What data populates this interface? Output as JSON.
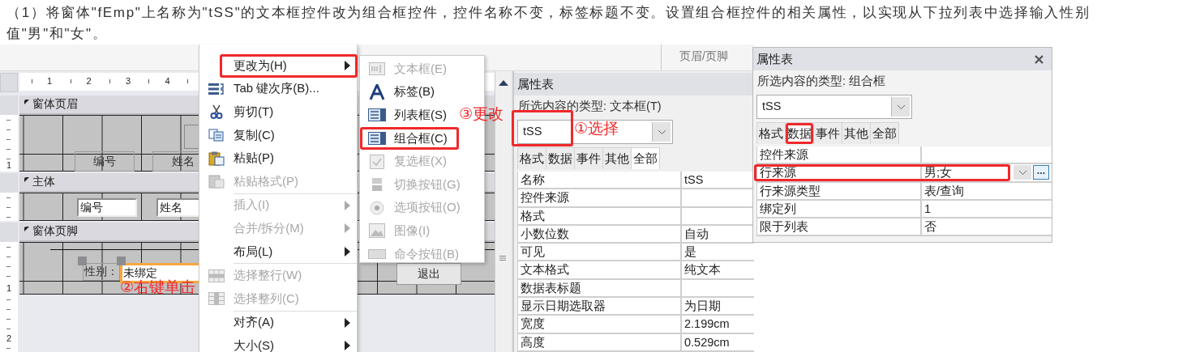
{
  "instruction": "（1）将窗体\"fEmp\"上名称为\"tSS\"的文本框控件改为组合框控件，控件名称不变，标签标题不变。设置组合框控件的相关属性，以实现从下拉列表中选择输入性别值\"男\"和\"女\"。",
  "ribbon": {
    "group_label": "页眉/页脚"
  },
  "designer": {
    "ruler_marks": [
      "1",
      "2",
      "3",
      "4"
    ],
    "sections": [
      {
        "title": "窗体页眉",
        "ruler_numbers": [
          "1"
        ],
        "controls": [
          {
            "kind": "label",
            "text": "编号",
            "selected": false
          },
          {
            "kind": "label",
            "text": "姓名",
            "selected": false
          },
          {
            "kind": "box",
            "selected": false
          }
        ]
      },
      {
        "title": "主体",
        "controls": [
          {
            "kind": "textbox",
            "text": "编号",
            "selected": false
          },
          {
            "kind": "textbox",
            "text": "姓名",
            "selected": false
          }
        ]
      },
      {
        "title": "窗体页脚",
        "ruler_numbers": [
          "1"
        ],
        "controls": [
          {
            "kind": "label",
            "text": "性别：",
            "selected": false
          },
          {
            "kind": "textbox",
            "text": "未绑定",
            "selected": true
          },
          {
            "kind": "button",
            "text": "退出",
            "selected": false
          }
        ]
      }
    ],
    "below_ruler_numbers": [
      "2"
    ]
  },
  "context_menu": {
    "items": [
      {
        "label": "更改为(H)",
        "disabled": false,
        "submenu": true
      },
      {
        "label": "Tab 键次序(B)...",
        "disabled": false,
        "submenu": false
      },
      {
        "label": "剪切(T)",
        "disabled": false,
        "submenu": false
      },
      {
        "label": "复制(C)",
        "disabled": false,
        "submenu": false
      },
      {
        "label": "粘贴(P)",
        "disabled": false,
        "submenu": false
      },
      {
        "label": "粘贴格式(P)",
        "disabled": true,
        "submenu": false
      },
      {
        "label": "插入(I)",
        "disabled": true,
        "submenu": true
      },
      {
        "label": "合并/拆分(M)",
        "disabled": true,
        "submenu": true
      },
      {
        "label": "布局(L)",
        "disabled": false,
        "submenu": true
      },
      {
        "label": "选择整行(W)",
        "disabled": true,
        "submenu": false
      },
      {
        "label": "选择整列(C)",
        "disabled": true,
        "submenu": false
      },
      {
        "label": "对齐(A)",
        "disabled": false,
        "submenu": true
      },
      {
        "label": "大小(S)",
        "disabled": false,
        "submenu": true
      }
    ]
  },
  "submenu": {
    "items": [
      {
        "label": "文本框(E)",
        "disabled": true
      },
      {
        "label": "标签(B)",
        "disabled": false
      },
      {
        "label": "列表框(S)",
        "disabled": false
      },
      {
        "label": "组合框(C)",
        "disabled": false
      },
      {
        "label": "复选框(X)",
        "disabled": true
      },
      {
        "label": "切换按钮(G)",
        "disabled": true
      },
      {
        "label": "选项按钮(O)",
        "disabled": true
      },
      {
        "label": "图像(I)",
        "disabled": true
      },
      {
        "label": "命令按钮(B)",
        "disabled": true
      }
    ]
  },
  "property_sheets": [
    {
      "title": "属性表",
      "selection_type": "所选内容的类型: 文本框(T)",
      "object": "tSS",
      "closable": false,
      "tabs": [
        {
          "label": "格式",
          "selected": false
        },
        {
          "label": "数据",
          "selected": false
        },
        {
          "label": "事件",
          "selected": false
        },
        {
          "label": "其他",
          "selected": false
        },
        {
          "label": "全部",
          "selected": true
        }
      ],
      "rows": [
        {
          "kind": "text",
          "name": "名称",
          "value": "tSS"
        },
        {
          "kind": "text",
          "name": "控件来源"
        },
        {
          "kind": "text",
          "name": "格式"
        },
        {
          "kind": "text",
          "name": "小数位数",
          "value": "自动"
        },
        {
          "kind": "text",
          "name": "可见",
          "value": "是"
        },
        {
          "kind": "text",
          "name": "文本格式",
          "value": "纯文本"
        },
        {
          "kind": "text",
          "name": "数据表标题"
        },
        {
          "kind": "text",
          "name": "显示日期选取器",
          "value": "为日期"
        },
        {
          "kind": "text",
          "name": "宽度",
          "value": "2.199cm"
        },
        {
          "kind": "text",
          "name": "高度",
          "value": "0.529cm"
        }
      ]
    },
    {
      "title": "属性表",
      "selection_type": "所选内容的类型: 组合框",
      "object": "tSS",
      "closable": true,
      "tabs": [
        {
          "label": "格式",
          "selected": false
        },
        {
          "label": "数据",
          "selected": true
        },
        {
          "label": "事件",
          "selected": false
        },
        {
          "label": "其他",
          "selected": false
        },
        {
          "label": "全部",
          "selected": false
        }
      ],
      "rows": [
        {
          "kind": "text",
          "name": "控件来源"
        },
        {
          "kind": "dropdown",
          "name": "行来源",
          "value": "男;女"
        },
        {
          "kind": "text",
          "name": "行来源类型",
          "value": "表/查询"
        },
        {
          "kind": "text",
          "name": "绑定列",
          "value": "1"
        },
        {
          "kind": "text",
          "name": "限于列表",
          "value": "否"
        }
      ]
    }
  ],
  "annotations": [
    {
      "text": "①选择"
    },
    {
      "text": "②右键单击"
    },
    {
      "text": "③更改"
    }
  ]
}
